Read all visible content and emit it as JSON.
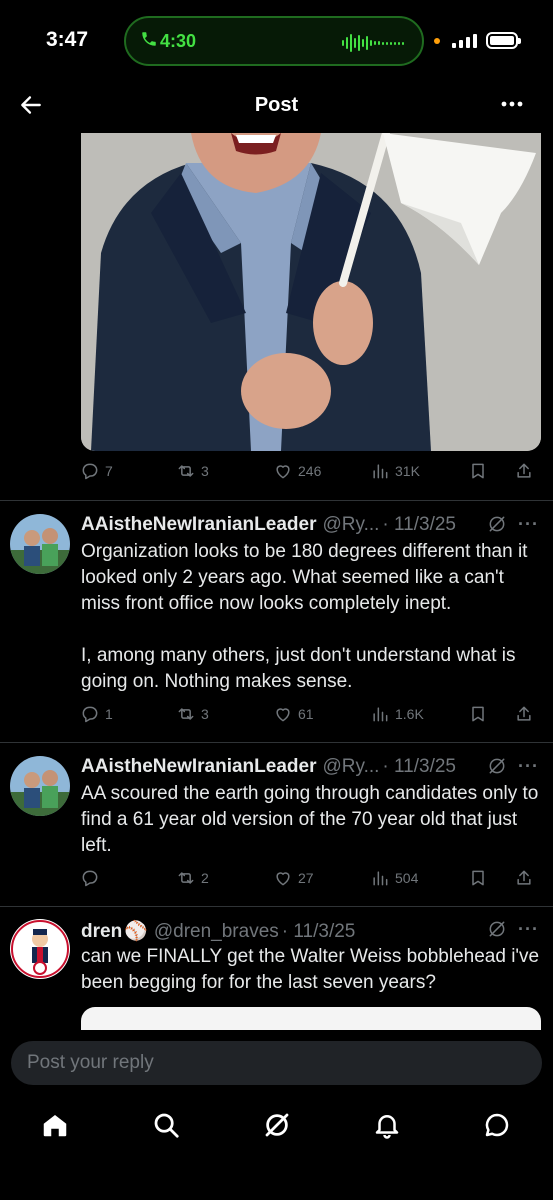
{
  "status_bar": {
    "time": "3:47",
    "call_time": "4:30"
  },
  "nav": {
    "title": "Post"
  },
  "main_post": {
    "stats": {
      "replies": "7",
      "reposts": "3",
      "likes": "246",
      "views": "31K"
    }
  },
  "replies": [
    {
      "name": "AAistheNewIranianLeader",
      "handle": "@Ry...",
      "date": "· 11/3/25",
      "text": "Organization looks to be 180 degrees different than it looked only 2 years ago. What seemed like a can't miss front office now looks completely inept.\n\nI, among many others, just don't understand what is going on. Nothing makes sense.",
      "stats": {
        "replies": "1",
        "reposts": "3",
        "likes": "61",
        "views": "1.6K"
      }
    },
    {
      "name": "AAistheNewIranianLeader",
      "handle": "@Ry...",
      "date": "· 11/3/25",
      "text": "AA scoured the earth going through candidates only to find a 61 year old version of the 70 year old that just left.",
      "stats": {
        "replies": "",
        "reposts": "2",
        "likes": "27",
        "views": "504"
      }
    },
    {
      "name": "dren",
      "name_emoji": "⚾",
      "handle": "@dren_braves",
      "date": "· 11/3/25",
      "text": "can we FINALLY get the Walter Weiss bobblehead i've been begging for for the last seven years?"
    }
  ],
  "composer": {
    "placeholder": "Post your reply"
  },
  "colors": {
    "background": "#000000",
    "text": "#e7e9ea",
    "muted": "#71767b",
    "call_green": "#43e043",
    "divider": "#2f3336"
  },
  "icons": [
    "back-arrow-icon",
    "more-icon",
    "reply-icon",
    "repost-icon",
    "like-icon",
    "views-icon",
    "bookmark-icon",
    "share-icon",
    "grok-icon",
    "home-icon",
    "search-icon",
    "notifications-icon",
    "messages-icon",
    "phone-icon"
  ]
}
